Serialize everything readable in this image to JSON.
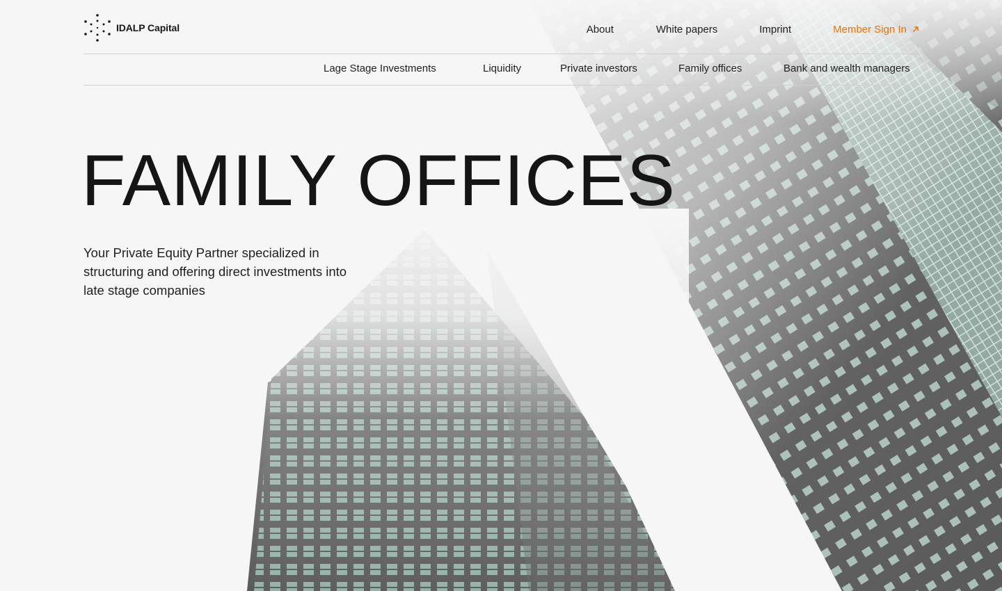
{
  "brand": {
    "name": "IDALP Capital"
  },
  "top_nav": {
    "about": "About",
    "white_papers": "White papers",
    "imprint": "Imprint",
    "member_sign_in": "Member Sign In"
  },
  "sub_nav": {
    "late_stage": "Lage Stage Investments",
    "liquidity": "Liquidity",
    "private_investors": "Private investors",
    "family_offices": "Family offices",
    "bank_wealth": "Bank and wealth managers"
  },
  "hero": {
    "title": "FAMILY OFFICES",
    "subtitle": "Your Private Equity Partner specialized in structuring and offering direct investments into late stage companies",
    "image": "skyscrapers-photo"
  },
  "colors": {
    "accent": "#e2740f",
    "background": "#f6f6f6",
    "text": "#151515",
    "divider": "#cfcfcf"
  }
}
